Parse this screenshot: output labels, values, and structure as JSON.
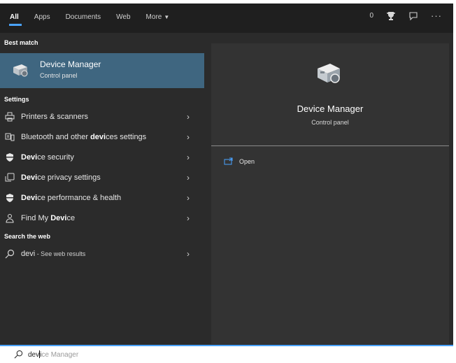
{
  "tabs": [
    {
      "label": "All"
    },
    {
      "label": "Apps"
    },
    {
      "label": "Documents"
    },
    {
      "label": "Web"
    },
    {
      "label": "More"
    }
  ],
  "topbar": {
    "points": "0"
  },
  "sections": {
    "best_match": "Best match",
    "settings": "Settings",
    "search_web": "Search the web"
  },
  "best": {
    "title": "Device Manager",
    "subtitle": "Control panel"
  },
  "settings_items": [
    {
      "pre": "Printers & scanners",
      "bold": "",
      "post": ""
    },
    {
      "pre": "Bluetooth and other ",
      "bold": "devi",
      "post": "ces settings"
    },
    {
      "pre": "",
      "bold": "Devi",
      "post": "ce security"
    },
    {
      "pre": "",
      "bold": "Devi",
      "post": "ce privacy settings"
    },
    {
      "pre": "",
      "bold": "Devi",
      "post": "ce performance & health"
    },
    {
      "pre": "Find My ",
      "bold": "Devi",
      "post": "ce"
    }
  ],
  "web": {
    "query": "devi",
    "suffix": " - See web results"
  },
  "preview": {
    "title": "Device Manager",
    "subtitle": "Control panel",
    "open_label": "Open"
  },
  "search": {
    "typed_a": "dev",
    "typed_b": "i",
    "suggestion": "ce Manager"
  },
  "colors": {
    "accent": "#4aa3ff",
    "selected": "#3f6680",
    "panel": "#2b2b2b",
    "preview": "#333333"
  }
}
